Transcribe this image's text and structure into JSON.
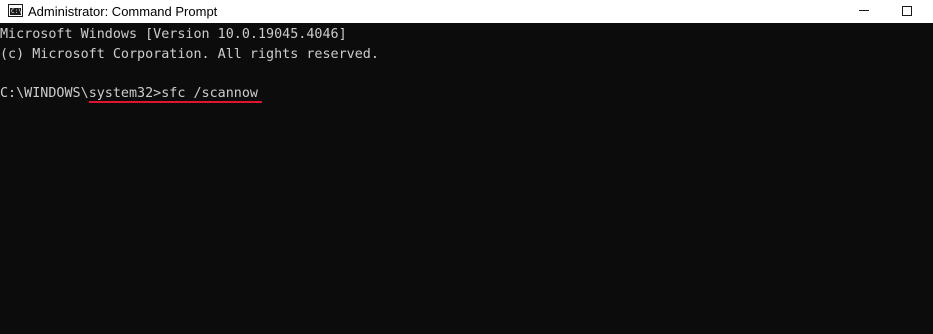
{
  "window": {
    "title": "Administrator: Command Prompt",
    "icon": "cmd-icon",
    "icon_text": "C:\\"
  },
  "title_controls": {
    "minimize_icon": "minimize-icon",
    "maximize_icon": "maximize-icon"
  },
  "console": {
    "line1": "Microsoft Windows [Version 10.0.19045.4046]",
    "line2": "(c) Microsoft Corporation. All rights reserved.",
    "line3": "",
    "prompt_start": "C:\\WINDOWS\\",
    "prompt_rest": "system32>",
    "command": "sfc /scannow"
  },
  "annotation": {
    "underline_color": "#e1132e"
  }
}
